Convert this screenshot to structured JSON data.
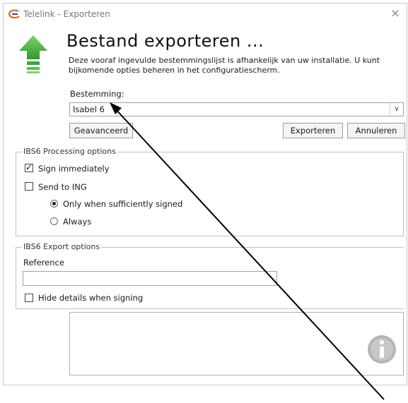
{
  "window": {
    "title": "Telelink - Exporteren",
    "close_glyph": "×"
  },
  "header": {
    "heading": "Bestand exporteren ...",
    "description": "Deze vooraf ingevulde bestemmingslijst is afhankelijk van uw installatie. U kunt bijkomende opties beheren in het configuratiescherm."
  },
  "destination": {
    "label": "Bestemming:",
    "value": "Isabel 6"
  },
  "buttons": {
    "advanced": "Geavanceerd",
    "export": "Exporteren",
    "cancel": "Annuleren"
  },
  "processing": {
    "title": "IBS6 Processing options",
    "sign_immediately": {
      "label": "Sign immediately",
      "checked": true
    },
    "send_to_ing": {
      "label": "Send to ING",
      "checked": false
    },
    "only_when_signed": {
      "label": "Only when sufficiently signed",
      "selected": true
    },
    "always": {
      "label": "Always",
      "selected": false
    }
  },
  "export_options": {
    "title": "IBS6 Export options",
    "reference_label": "Reference",
    "reference_value": "",
    "hide_details": {
      "label": "Hide details when signing",
      "checked": false
    }
  },
  "icons": {
    "app": "telelink-logo-icon",
    "arrow": "green-up-arrow-icon",
    "info": "info-icon"
  },
  "colors": {
    "arrow_green": "#3aa83a",
    "info_gray": "#b5b5b5"
  }
}
